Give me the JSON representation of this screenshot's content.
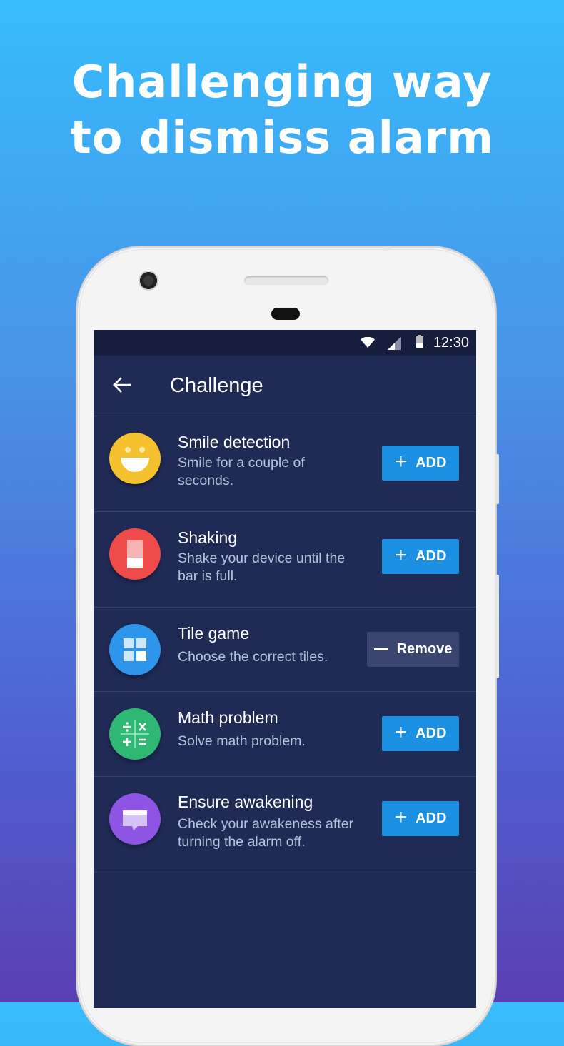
{
  "headline": {
    "line1": "Challenging way",
    "line2": "to dismiss alarm"
  },
  "status_bar": {
    "time": "12:30",
    "icons": [
      "wifi-icon",
      "signal-icon",
      "battery-icon"
    ]
  },
  "app_bar": {
    "title": "Challenge",
    "back_icon": "arrow-left-icon"
  },
  "challenges": [
    {
      "title": "Smile detection",
      "description": "Smile for a couple of seconds.",
      "icon": "smile-icon",
      "icon_color": "#f6c12f",
      "action": "ADD"
    },
    {
      "title": "Shaking",
      "description": "Shake your device until the bar is full.",
      "icon": "shake-bar-icon",
      "icon_color": "#ef4b4b",
      "action": "ADD"
    },
    {
      "title": "Tile game",
      "description": "Choose the correct tiles.",
      "icon": "tiles-icon",
      "icon_color": "#2f95ea",
      "action": "Remove"
    },
    {
      "title": "Math problem",
      "description": "Solve math problem.",
      "icon": "math-icon",
      "icon_color": "#2fb874",
      "action": "ADD"
    },
    {
      "title": "Ensure awakening",
      "description": "Check your awakeness after turning the alarm off.",
      "icon": "message-icon",
      "icon_color": "#8e54e4",
      "action": "ADD"
    }
  ],
  "colors": {
    "add_button": "#1b8fe2",
    "remove_button": "#3a4670",
    "screen_background": "#1f2a55"
  }
}
